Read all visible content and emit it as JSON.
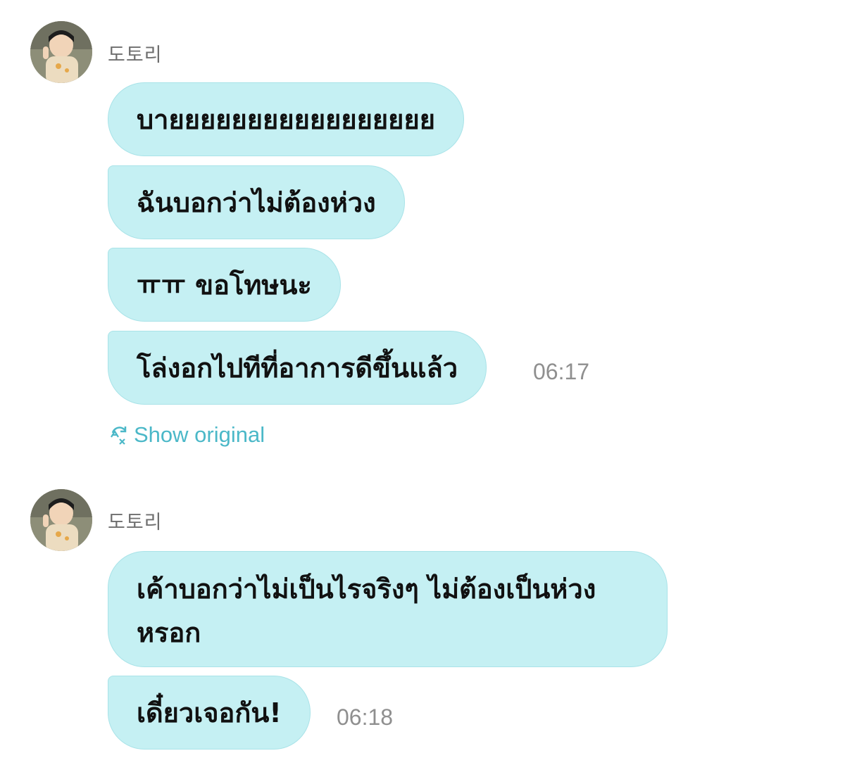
{
  "groups": [
    {
      "sender": "도토리",
      "messages": [
        "บายยยยยยยยยยยยยยยยย",
        "ฉันบอกว่าไม่ต้องห่วง",
        "ㅠㅠ ขอโทษนะ",
        "โล่งอกไปทีที่อาการดีขึ้นแล้ว"
      ],
      "time": "06:17",
      "show_original": "Show original"
    },
    {
      "sender": "도토리",
      "messages": [
        "เค้าบอกว่าไม่เป็นไรจริงๆ ไม่ต้องเป็นห่วงหรอก",
        "เดี๋ยวเจอกัน!"
      ],
      "time": "06:18"
    }
  ],
  "icons": {
    "avatar": "profile-photo-avatar",
    "translate": "translate-icon"
  },
  "colors": {
    "bubble": "#c5f0f3",
    "link": "#4bb8c8",
    "timestamp": "#8f8f8f"
  }
}
